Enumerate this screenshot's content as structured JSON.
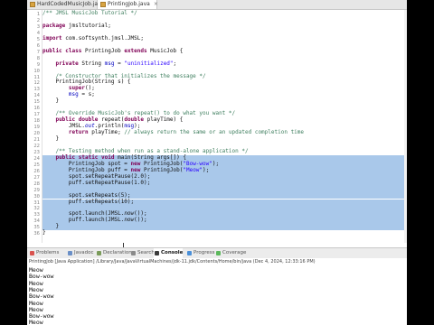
{
  "tabs": [
    {
      "label": "HardCodedMusicJob.java",
      "active": false
    },
    {
      "label": "PrintingJob.java",
      "active": true
    }
  ],
  "code_lines": [
    {
      "n": "1",
      "html": "<span class='cm'>/** JMSL MusicJob Tutorial */</span>",
      "sel": false
    },
    {
      "n": "2",
      "html": "",
      "sel": false
    },
    {
      "n": "3",
      "html": "<span class='kw'>package</span> jmsltutorial;",
      "sel": false
    },
    {
      "n": "4",
      "html": "",
      "sel": false
    },
    {
      "n": "5",
      "html": "<span class='kw'>import</span> com.softsynth.jmsl.JMSL;",
      "sel": false
    },
    {
      "n": "6",
      "html": "",
      "sel": false
    },
    {
      "n": "7",
      "html": "<span class='kw'>public class</span> PrintingJob <span class='kw'>extends</span> MusicJob {",
      "sel": false
    },
    {
      "n": "8",
      "html": "",
      "sel": false
    },
    {
      "n": "9",
      "html": "    <span class='kw'>private</span> String <span class='fd'>msg</span> = <span class='st'>\"uninitialized\"</span>;",
      "sel": false
    },
    {
      "n": "10",
      "html": "",
      "sel": false
    },
    {
      "n": "11",
      "html": "    <span class='cm'>/* Constructor that initializes the message */</span>",
      "sel": false
    },
    {
      "n": "12",
      "html": "    PrintingJob(String s) {",
      "sel": false
    },
    {
      "n": "13",
      "html": "        <span class='kw'>super</span>();",
      "sel": false
    },
    {
      "n": "14",
      "html": "        <span class='fd'>msg</span> = s;",
      "sel": false
    },
    {
      "n": "15",
      "html": "    }",
      "sel": false
    },
    {
      "n": "16",
      "html": "",
      "sel": false
    },
    {
      "n": "17",
      "html": "    <span class='cm'>/** Override MusicJob's repeat() to do what you want */</span>",
      "sel": false
    },
    {
      "n": "18",
      "html": "    <span class='kw'>public double</span> repeat(<span class='kw'>double</span> playTime) {",
      "sel": false
    },
    {
      "n": "19",
      "html": "        JMSL.<span class='fd it'>out</span>.println(<span class='fd'>msg</span>);",
      "sel": false
    },
    {
      "n": "20",
      "html": "        <span class='kw'>return</span> playTime; <span class='cm'>// always return the same or an updated completion time</span>",
      "sel": false
    },
    {
      "n": "21",
      "html": "    }",
      "sel": false
    },
    {
      "n": "22",
      "html": "",
      "sel": false
    },
    {
      "n": "23",
      "html": "    <span class='cm'>/** Testing method when run as a stand-alone application */</span>",
      "sel": false
    },
    {
      "n": "24",
      "html": "    <span class='kw'>public static void</span> main(String args[]) {",
      "sel": true
    },
    {
      "n": "25",
      "html": "        PrintingJob spot = <span class='kw'>new</span> PrintingJob(<span class='st'>\"Bow-wow\"</span>);",
      "sel": true
    },
    {
      "n": "26",
      "html": "        PrintingJob puff = <span class='kw'>new</span> PrintingJob(<span class='st'>\"Meow\"</span>);",
      "sel": true
    },
    {
      "n": "27",
      "html": "        spot.setRepeatPause(2.0);",
      "sel": true
    },
    {
      "n": "28",
      "html": "        puff.setRepeatPause(1.0);",
      "sel": true
    },
    {
      "n": "29",
      "html": "",
      "sel": true
    },
    {
      "n": "30",
      "html": "        spot.setRepeats(5);",
      "sel": true
    },
    {
      "n": "31",
      "html": "        puff.setRepeats(10);",
      "sel": true
    },
    {
      "n": "32",
      "html": "",
      "sel": true
    },
    {
      "n": "33",
      "html": "        spot.launch(JMSL.<span class='it'>now</span>());",
      "sel": true
    },
    {
      "n": "34",
      "html": "        puff.launch(JMSL.<span class='it'>now</span>());",
      "sel": true
    },
    {
      "n": "35",
      "html": "    }",
      "sel": true
    },
    {
      "n": "36",
      "html": "}",
      "sel": false
    }
  ],
  "panel_tabs": [
    {
      "label": "Problems",
      "color": "#d9534f"
    },
    {
      "label": "Javadoc",
      "color": "#6a8fc7"
    },
    {
      "label": "Declaration",
      "color": "#7a9b5a"
    },
    {
      "label": "Search",
      "color": "#8a8a8a"
    },
    {
      "label": "Console",
      "color": "#3b3b3b",
      "active": true
    },
    {
      "label": "Progress",
      "color": "#4a90d9"
    },
    {
      "label": "Coverage",
      "color": "#5cb85c"
    }
  ],
  "console_header": "PrintingJob [Java Application] /Library/Java/JavaVirtualMachines/jdk-11.jdk/Contents/Home/bin/java  (Dec 4, 2024, 12:33:16 PM)",
  "console_output": [
    "Meow",
    "Bow-wow",
    "Meow",
    "Meow",
    "Bow-wow",
    "Meow",
    "Meow",
    "Bow-wow",
    "Meow"
  ]
}
